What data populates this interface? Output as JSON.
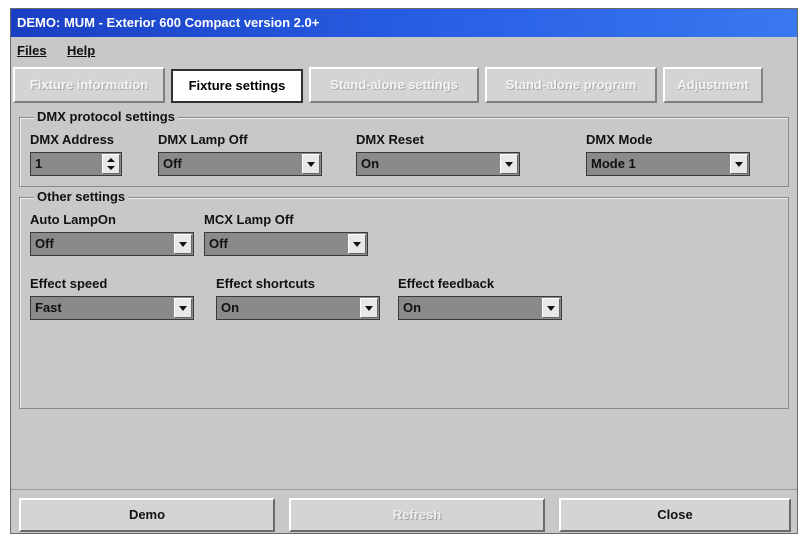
{
  "window": {
    "title": "DEMO: MUM - Exterior 600 Compact version 2.0+"
  },
  "menu": {
    "items": [
      "Files",
      "Help"
    ]
  },
  "tabs": [
    {
      "label": "Fixture information",
      "state": "disabled"
    },
    {
      "label": "Fixture settings",
      "state": "active"
    },
    {
      "label": "Stand-alone settings",
      "state": "disabled"
    },
    {
      "label": "Stand-alone program",
      "state": "disabled"
    },
    {
      "label": "Adjustment",
      "state": "disabled"
    }
  ],
  "dmx_group": {
    "title": "DMX protocol settings",
    "address": {
      "label": "DMX Address",
      "value": "1"
    },
    "lamp_off": {
      "label": "DMX Lamp Off",
      "value": "Off"
    },
    "reset": {
      "label": "DMX Reset",
      "value": "On"
    },
    "mode": {
      "label": "DMX Mode",
      "value": "Mode 1"
    }
  },
  "other_group": {
    "title": "Other settings",
    "auto_lamp_on": {
      "label": "Auto LampOn",
      "value": "Off"
    },
    "mcx_lamp_off": {
      "label": "MCX Lamp Off",
      "value": "Off"
    },
    "effect_speed": {
      "label": "Effect speed",
      "value": "Fast"
    },
    "effect_shortcuts": {
      "label": "Effect shortcuts",
      "value": "On"
    },
    "effect_feedback": {
      "label": "Effect feedback",
      "value": "On"
    }
  },
  "buttons": {
    "demo": "Demo",
    "refresh": "Refresh",
    "close": "Close"
  },
  "colors": {
    "titlebar": "#2a62e6",
    "window_bg": "#c8c8c8",
    "combo_bg": "#8a8a8a"
  }
}
